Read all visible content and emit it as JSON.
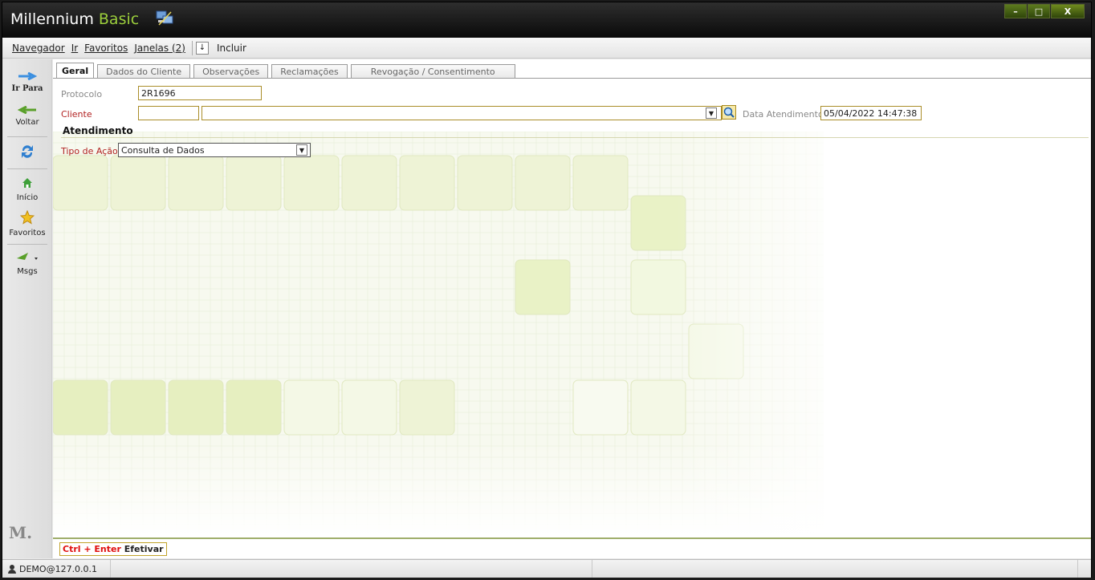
{
  "window": {
    "title_main": "Millennium",
    "title_accent": "Basic",
    "buttons": {
      "minimize": "–",
      "maximize": "□",
      "close": "X"
    }
  },
  "menu": {
    "items": [
      "Navegador",
      "Ir",
      "Favoritos",
      "Janelas (2)"
    ],
    "dropdown_icon": "↓",
    "incluir": "Incluir"
  },
  "nav": {
    "ir_para": "Ir Para",
    "voltar": "Voltar",
    "inicio": "Início",
    "favoritos": "Favoritos",
    "msgs": "Msgs",
    "logo": "M."
  },
  "tabs": [
    "Geral",
    "Dados do Cliente",
    "Observações",
    "Reclamações",
    "Revogação / Consentimento"
  ],
  "form": {
    "protocolo_label": "Protocolo",
    "protocolo_value": "2R1696",
    "cliente_label": "Cliente",
    "cliente_code": "",
    "cliente_name": "",
    "data_label": "Data Atendimento",
    "data_value": "05/04/2022 14:47:38",
    "section_title": "Atendimento",
    "tipo_label": "Tipo de Ação",
    "tipo_value": "Consulta de Dados"
  },
  "action": {
    "key": "Ctrl + Enter",
    "label": "Efetivar"
  },
  "status": {
    "user": "DEMO@127.0.0.1"
  },
  "colors": {
    "accent_green": "#9ccf3c",
    "required_label": "#b22222",
    "field_border": "#aa8e2a"
  }
}
